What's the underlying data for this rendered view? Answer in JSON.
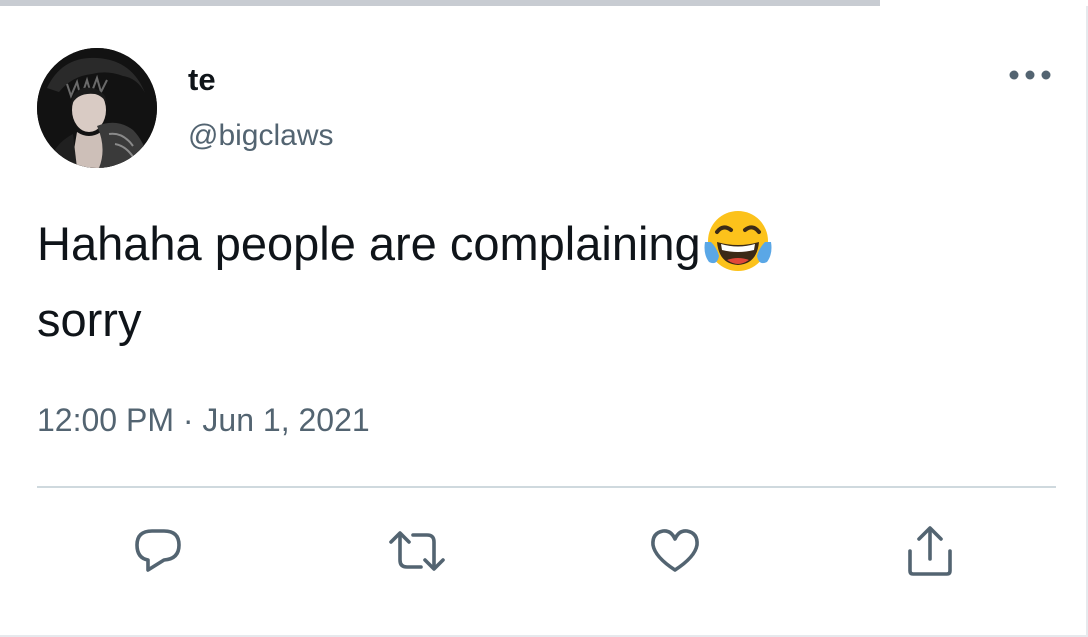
{
  "user": {
    "display_name": "te",
    "handle": "@bigclaws",
    "avatar_icon": "user-avatar-photo"
  },
  "tweet": {
    "lines": [
      "Hahaha people are complaining",
      "sorry"
    ],
    "emoji": "face-with-tears-of-joy",
    "time": "12:00 PM",
    "separator": "·",
    "date": "Jun 1, 2021"
  },
  "actions": [
    {
      "name": "reply",
      "icon": "reply-icon"
    },
    {
      "name": "retweet",
      "icon": "retweet-icon"
    },
    {
      "name": "like",
      "icon": "heart-icon"
    },
    {
      "name": "share",
      "icon": "share-icon"
    }
  ],
  "colors": {
    "text": "#0f1419",
    "secondary": "#536471",
    "divider": "#cfd9de"
  }
}
